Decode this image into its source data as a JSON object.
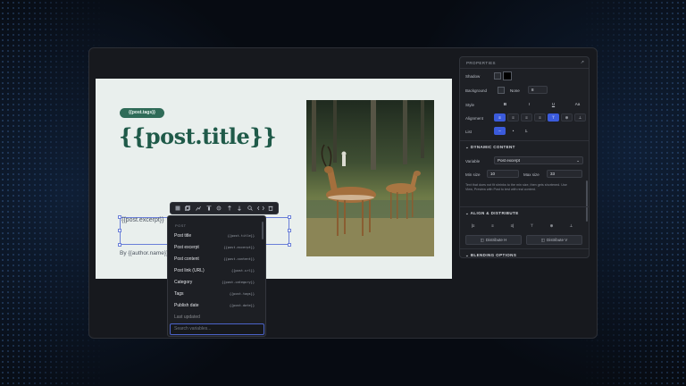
{
  "canvas": {
    "tag": "{{post.tags}}",
    "title": "{{post.title}}",
    "excerpt": "{{post.excerpt}}",
    "author": "By {{author.name}}"
  },
  "toolbar": {
    "icons": [
      "select-icon",
      "copy-icon",
      "chart-icon",
      "align-top-icon",
      "target-icon",
      "up-icon",
      "down-icon",
      "zoom-icon",
      "code-icon",
      "trash-icon"
    ]
  },
  "variables": {
    "section": "POST",
    "items": [
      {
        "name": "Post title",
        "key": "{{post.title}}"
      },
      {
        "name": "Post excerpt",
        "key": "{{post.excerpt}}"
      },
      {
        "name": "Post content",
        "key": "{{post.content}}"
      },
      {
        "name": "Post link (URL)",
        "key": "{{post.url}}"
      },
      {
        "name": "Category",
        "key": "{{post.category}}"
      },
      {
        "name": "Tags",
        "key": "{{post.tags}}"
      },
      {
        "name": "Publish date",
        "key": "{{post.date}}"
      },
      {
        "name": "Last updated",
        "key": ""
      }
    ],
    "search_placeholder": "Search variables..."
  },
  "properties": {
    "title": "PROPERTIES",
    "shadow_label": "Shadow",
    "background_label": "Background",
    "background_value": "None",
    "background_number": "8",
    "style_label": "Style",
    "style_options": [
      "B",
      "I",
      "U",
      "Aa"
    ],
    "alignment_label": "Alignment",
    "list_label": "List",
    "dynamic_content": {
      "heading": "DYNAMIC CONTENT",
      "variable_label": "Variable",
      "variable_value": "Post excerpt",
      "min_size_label": "Min size",
      "min_size_value": "10",
      "max_size_label": "Max size",
      "max_size_value": "33",
      "note": "Text that does not fit shrinks to the min size, then gets shortened. Use View, Preview with Post to test with real content."
    },
    "align_distribute": {
      "heading": "ALIGN & DISTRIBUTE",
      "distribute_h": "Distribute H",
      "distribute_v": "Distribute V"
    },
    "blending": {
      "heading": "BLENDING OPTIONS"
    }
  },
  "colors": {
    "accent": "#3b5bdb",
    "brand_green": "#1f5a49"
  }
}
